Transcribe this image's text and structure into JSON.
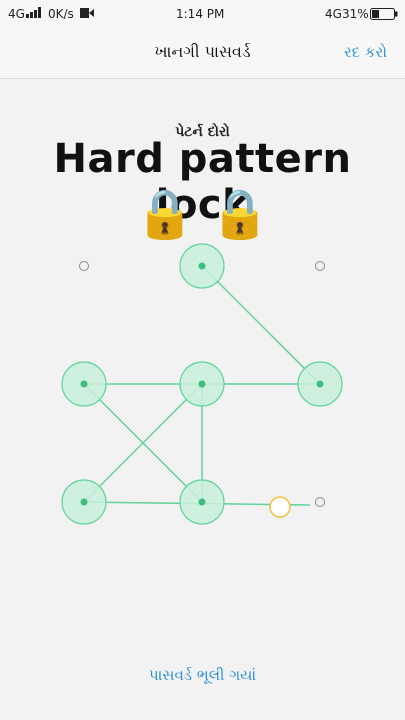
{
  "status_bar": {
    "network_left": "4G",
    "speed": "0K/s",
    "time": "1:14 PM",
    "network_right": "4G",
    "battery": "31%"
  },
  "header": {
    "title": "ખાનગી પાસવર્ડ",
    "cancel_label": "રદ કરો"
  },
  "prompt": "પેટર્ન દોરો",
  "overlay_title": "Hard pattern lock",
  "lock_emojis": "🔒 🔒",
  "forgot_link": "પાસવર્ડ ભૂલી ગયાં",
  "pattern": {
    "selected_dots": [
      2,
      4,
      5,
      6,
      7,
      8
    ],
    "path": [
      2,
      6,
      4,
      8,
      5,
      7
    ],
    "pending_dot": 9,
    "colors": {
      "line": "#5fd39a",
      "fill": "#c9f0da",
      "pending": "#f0c040",
      "idle": "#8a8a8a"
    }
  }
}
